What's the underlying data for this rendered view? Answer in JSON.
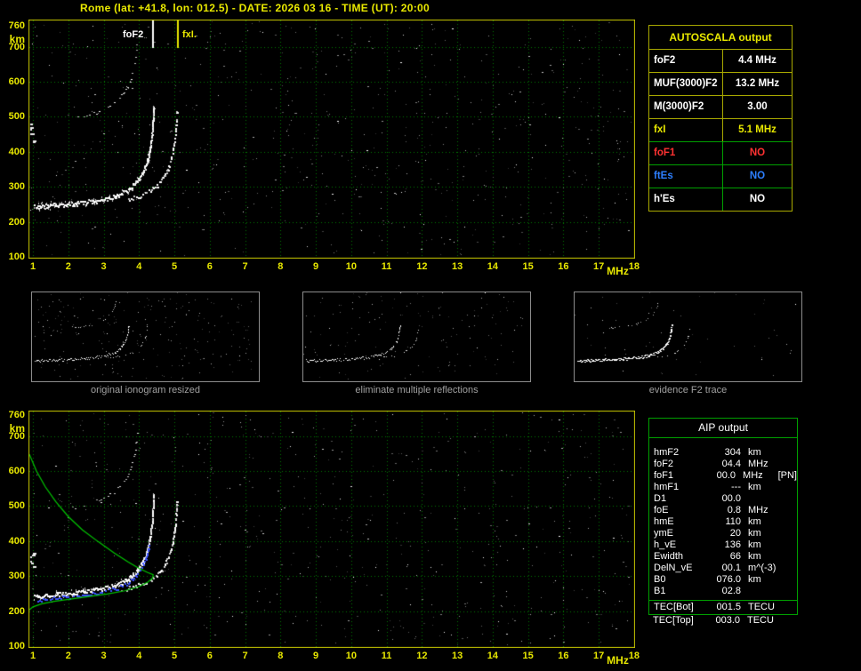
{
  "header": {
    "title": "Rome (lat: +41.8, lon: 012.5) - DATE: 2026 03 16 - TIME (UT): 20:00"
  },
  "colors": {
    "background": "#000000",
    "axis_text": "#e8e800",
    "grid": "#007a00",
    "plot_border": "#c8c800",
    "trace": "#ffffff",
    "second_hop": "#b4b4b4",
    "profile": "#00c800",
    "restored_trace": "#3c50ff",
    "fof2_marker": "#ffffff",
    "fxi_marker": "#e8e800",
    "autoscala_border": "#a8a800",
    "aip_border": "#00a000",
    "caption_text": "#a0a0a0",
    "no_red": "#ff3232",
    "es_blue": "#2d7fff"
  },
  "markers": {
    "fof2_label": "foF2",
    "fxi_label": "fxI.",
    "fof2_mhz": 4.4,
    "fxi_mhz": 5.1
  },
  "autoscala": {
    "title": "AUTOSCALA output",
    "rows": [
      {
        "label": "foF2",
        "value": "4.4 MHz",
        "color": "#ffffff"
      },
      {
        "label": "MUF(3000)F2",
        "value": "13.2 MHz",
        "color": "#ffffff"
      },
      {
        "label": "M(3000)F2",
        "value": "3.00",
        "color": "#ffffff"
      },
      {
        "label": "fxI",
        "value": "5.1 MHz",
        "color": "#e8e800"
      },
      {
        "label": "foF1",
        "value": "NO",
        "color": "#ff3232"
      },
      {
        "label": "ftEs",
        "value": "NO",
        "color": "#2d7fff"
      },
      {
        "label": "h'Es",
        "value": "NO",
        "color": "#ffffff"
      }
    ]
  },
  "thumbnails": [
    {
      "caption": "original ionogram resized"
    },
    {
      "caption": "eliminate multiple reflections"
    },
    {
      "caption": "evidence F2 trace"
    }
  ],
  "aip": {
    "title": "AIP output",
    "rows": [
      {
        "label": "hmF2",
        "value": "304",
        "unit": "km",
        "extra": ""
      },
      {
        "label": "foF2",
        "value": "04.4",
        "unit": "MHz",
        "extra": ""
      },
      {
        "label": "foF1",
        "value": "00.0",
        "unit": "MHz",
        "extra": "[PN]"
      },
      {
        "label": "hmF1",
        "value": "---",
        "unit": "km",
        "extra": ""
      },
      {
        "label": "D1",
        "value": "00.0",
        "unit": "",
        "extra": ""
      },
      {
        "label": "foE",
        "value": "0.8",
        "unit": "MHz",
        "extra": ""
      },
      {
        "label": "hmE",
        "value": "110",
        "unit": "km",
        "extra": ""
      },
      {
        "label": "ymE",
        "value": "20",
        "unit": "km",
        "extra": ""
      },
      {
        "label": "h_vE",
        "value": "136",
        "unit": "km",
        "extra": ""
      },
      {
        "label": "Ewidth",
        "value": "66",
        "unit": "km",
        "extra": ""
      },
      {
        "label": "DelN_vE",
        "value": "00.1",
        "unit": "m^(-3)",
        "extra": ""
      },
      {
        "label": "B0",
        "value": "076.0",
        "unit": "km",
        "extra": ""
      },
      {
        "label": "B1",
        "value": "02.8",
        "unit": "",
        "extra": ""
      }
    ],
    "tec_rows": [
      {
        "label": "TEC[Bot]",
        "value": "001.5",
        "unit": "TECU",
        "extra": ""
      },
      {
        "label": "TEC[Top]",
        "value": "003.0",
        "unit": "TECU",
        "extra": ""
      }
    ]
  },
  "chart_data": [
    {
      "type": "scatter",
      "title": "scaled ionogram with AUTOSCALA markers",
      "xlabel": "MHz",
      "ylabel": "km",
      "xlim": [
        1,
        18
      ],
      "ylim": [
        100,
        760
      ],
      "grid": true,
      "x_ticks": [
        1,
        2,
        3,
        4,
        5,
        6,
        7,
        8,
        9,
        10,
        11,
        12,
        13,
        14,
        15,
        16,
        17,
        18
      ],
      "y_ticks": [
        760,
        700,
        600,
        500,
        400,
        300,
        200,
        100
      ],
      "series": [
        {
          "name": "O-mode trace",
          "points": [
            [
              1.05,
              243
            ],
            [
              1.5,
              246
            ],
            [
              2.0,
              250
            ],
            [
              2.5,
              256
            ],
            [
              3.0,
              264
            ],
            [
              3.4,
              276
            ],
            [
              3.7,
              290
            ],
            [
              3.9,
              308
            ],
            [
              4.05,
              328
            ],
            [
              4.2,
              360
            ],
            [
              4.3,
              400
            ],
            [
              4.37,
              450
            ],
            [
              4.42,
              530
            ]
          ]
        },
        {
          "name": "X-mode trace",
          "points": [
            [
              3.66,
              264
            ],
            [
              4.06,
              276
            ],
            [
              4.36,
              290
            ],
            [
              4.56,
              308
            ],
            [
              4.71,
              328
            ],
            [
              4.86,
              360
            ],
            [
              4.96,
              400
            ],
            [
              5.03,
              450
            ],
            [
              5.08,
              520
            ]
          ]
        },
        {
          "name": "second-hop echo",
          "points": [
            [
              2.2,
              495
            ],
            [
              2.6,
              505
            ],
            [
              3.0,
              520
            ],
            [
              3.3,
              540
            ],
            [
              3.55,
              565
            ],
            [
              3.75,
              600
            ],
            [
              3.88,
              650
            ],
            [
              3.96,
              715
            ]
          ]
        }
      ],
      "annotations": [
        {
          "label": "foF2",
          "mhz": 4.4
        },
        {
          "label": "fxI.",
          "mhz": 5.1
        }
      ]
    },
    {
      "type": "scatter",
      "title": "ionogram with restored trace and electron density profile",
      "xlabel": "MHz",
      "ylabel": "km",
      "xlim": [
        1,
        18
      ],
      "ylim": [
        100,
        760
      ],
      "grid": true,
      "x_ticks": [
        1,
        2,
        3,
        4,
        5,
        6,
        7,
        8,
        9,
        10,
        11,
        12,
        13,
        14,
        15,
        16,
        17,
        18
      ],
      "y_ticks": [
        760,
        700,
        600,
        500,
        400,
        300,
        200,
        100
      ],
      "series": [
        {
          "name": "O-mode trace",
          "points": [
            [
              1.05,
              243
            ],
            [
              1.5,
              246
            ],
            [
              2.0,
              250
            ],
            [
              2.5,
              256
            ],
            [
              3.0,
              264
            ],
            [
              3.4,
              276
            ],
            [
              3.7,
              290
            ],
            [
              3.9,
              308
            ],
            [
              4.05,
              328
            ],
            [
              4.2,
              360
            ],
            [
              4.3,
              400
            ],
            [
              4.37,
              450
            ],
            [
              4.42,
              530
            ]
          ]
        },
        {
          "name": "X-mode trace",
          "points": [
            [
              3.66,
              264
            ],
            [
              4.06,
              276
            ],
            [
              4.36,
              290
            ],
            [
              4.56,
              308
            ],
            [
              4.71,
              328
            ],
            [
              4.86,
              360
            ],
            [
              4.96,
              400
            ],
            [
              5.03,
              450
            ],
            [
              5.08,
              520
            ]
          ]
        },
        {
          "name": "second-hop echo",
          "points": [
            [
              2.2,
              495
            ],
            [
              2.6,
              505
            ],
            [
              3.0,
              520
            ],
            [
              3.3,
              540
            ],
            [
              3.55,
              565
            ],
            [
              3.75,
              600
            ],
            [
              3.88,
              650
            ],
            [
              3.96,
              715
            ]
          ]
        },
        {
          "name": "restored trace",
          "points": [
            [
              1.15,
              233
            ],
            [
              1.6,
              236
            ],
            [
              2.1,
              241
            ],
            [
              2.6,
              247
            ],
            [
              3.0,
              254
            ],
            [
              3.4,
              266
            ],
            [
              3.7,
              280
            ],
            [
              3.9,
              298
            ],
            [
              4.05,
              318
            ],
            [
              4.2,
              350
            ],
            [
              4.3,
              390
            ]
          ]
        },
        {
          "name": "electron density profile",
          "points": [
            [
              0.9,
              648
            ],
            [
              1.1,
              600
            ],
            [
              1.35,
              555
            ],
            [
              1.65,
              512
            ],
            [
              2.0,
              470
            ],
            [
              2.4,
              432
            ],
            [
              2.85,
              398
            ],
            [
              3.3,
              366
            ],
            [
              3.7,
              340
            ],
            [
              4.0,
              322
            ],
            [
              4.25,
              310
            ],
            [
              4.4,
              304
            ],
            [
              4.38,
              294
            ],
            [
              4.25,
              283
            ],
            [
              4.0,
              270
            ],
            [
              3.6,
              258
            ],
            [
              3.1,
              249
            ],
            [
              2.6,
              242
            ],
            [
              2.1,
              235
            ],
            [
              1.6,
              228
            ],
            [
              1.25,
              221
            ],
            [
              1.0,
              212
            ],
            [
              0.9,
              204
            ],
            [
              0.87,
              199
            ]
          ]
        }
      ]
    }
  ]
}
